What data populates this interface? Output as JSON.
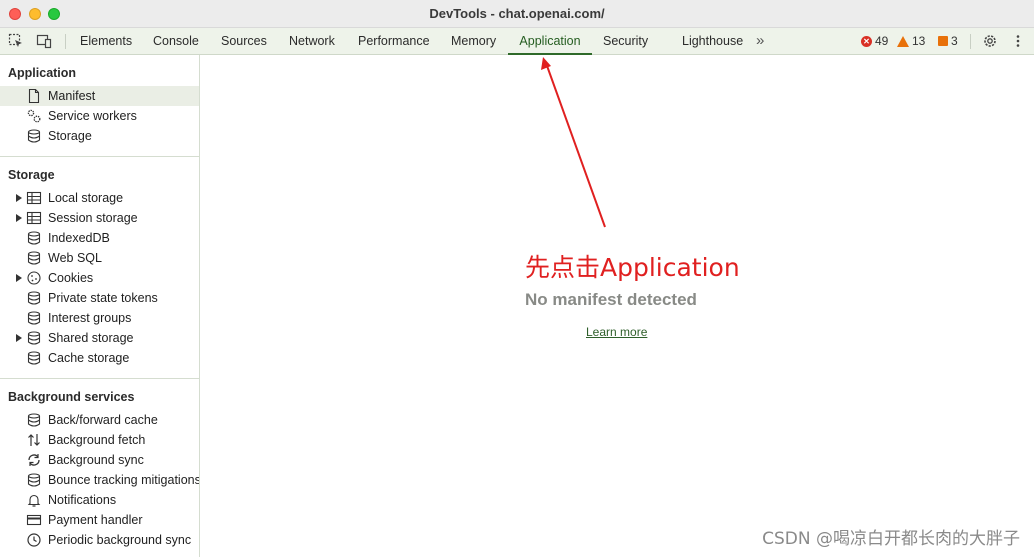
{
  "window": {
    "title": "DevTools - chat.openai.com/"
  },
  "tabs": [
    {
      "label": "Elements"
    },
    {
      "label": "Console"
    },
    {
      "label": "Sources"
    },
    {
      "label": "Network"
    },
    {
      "label": "Performance"
    },
    {
      "label": "Memory"
    },
    {
      "label": "Application"
    },
    {
      "label": "Security"
    },
    {
      "label": "Lighthouse"
    }
  ],
  "issues": {
    "errors": "49",
    "warnings": "13",
    "info": "3"
  },
  "sidebar": {
    "application": {
      "title": "Application",
      "items": [
        {
          "label": "Manifest",
          "icon": "document-icon"
        },
        {
          "label": "Service workers",
          "icon": "gears-icon"
        },
        {
          "label": "Storage",
          "icon": "database-icon"
        }
      ]
    },
    "storage": {
      "title": "Storage",
      "items": [
        {
          "label": "Local storage",
          "icon": "table-icon"
        },
        {
          "label": "Session storage",
          "icon": "table-icon"
        },
        {
          "label": "IndexedDB",
          "icon": "database-icon"
        },
        {
          "label": "Web SQL",
          "icon": "database-icon"
        },
        {
          "label": "Cookies",
          "icon": "cookie-icon"
        },
        {
          "label": "Private state tokens",
          "icon": "database-icon"
        },
        {
          "label": "Interest groups",
          "icon": "database-icon"
        },
        {
          "label": "Shared storage",
          "icon": "database-icon"
        },
        {
          "label": "Cache storage",
          "icon": "database-icon"
        }
      ]
    },
    "background": {
      "title": "Background services",
      "items": [
        {
          "label": "Back/forward cache",
          "icon": "database-icon"
        },
        {
          "label": "Background fetch",
          "icon": "up-down-arrows-icon"
        },
        {
          "label": "Background sync",
          "icon": "sync-icon"
        },
        {
          "label": "Bounce tracking mitigations",
          "icon": "database-icon"
        },
        {
          "label": "Notifications",
          "icon": "bell-icon"
        },
        {
          "label": "Payment handler",
          "icon": "card-icon"
        },
        {
          "label": "Periodic background sync",
          "icon": "clock-icon"
        }
      ]
    }
  },
  "main": {
    "empty_title": "No manifest detected",
    "learn_more": "Learn more",
    "annotation": "先点击Application"
  },
  "watermark": "CSDN @喝凉白开都长肉的大胖子",
  "colors": {
    "active_tab": "#255d21",
    "annotation": "#e02020",
    "error": "#d93025",
    "warning": "#e8710a"
  }
}
